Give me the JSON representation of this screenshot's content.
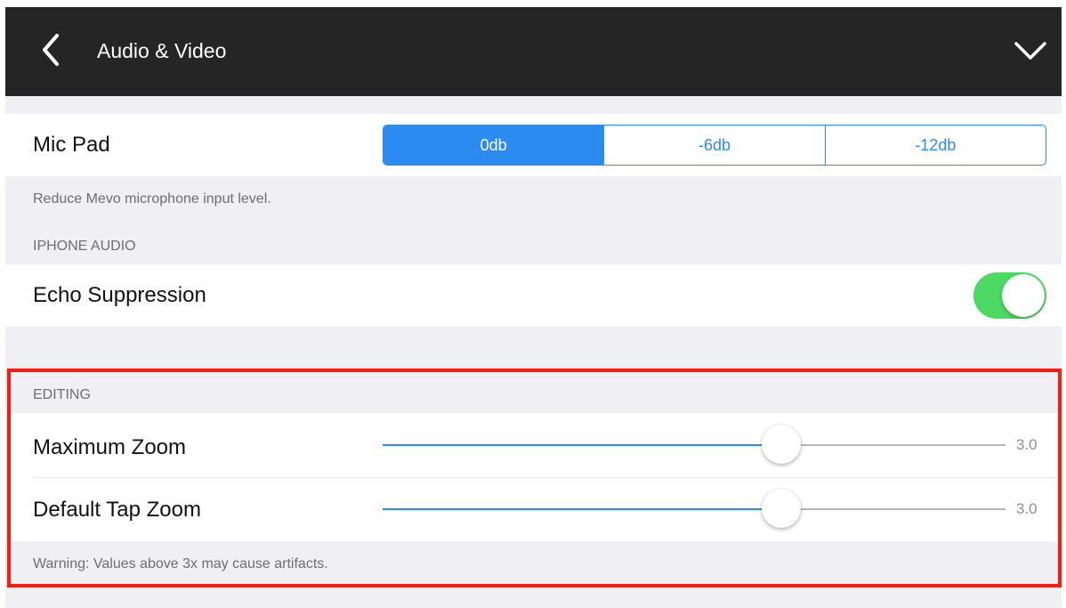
{
  "nav": {
    "title": "Audio & Video",
    "back_icon": "chevron-left-icon",
    "menu_icon": "chevron-down-icon"
  },
  "mic_pad": {
    "label": "Mic Pad",
    "options": [
      "0db",
      "-6db",
      "-12db"
    ],
    "selected": "0db",
    "footnote": "Reduce Mevo microphone input level."
  },
  "iphone_audio": {
    "header": "IPHONE AUDIO",
    "echo_suppression": {
      "label": "Echo Suppression",
      "on": true
    }
  },
  "editing": {
    "header": "EDITING",
    "maximum_zoom": {
      "label": "Maximum Zoom",
      "value": "3.0",
      "fraction": 0.64
    },
    "default_tap_zoom": {
      "label": "Default Tap Zoom",
      "value": "3.0",
      "fraction": 0.64
    },
    "footnote": "Warning: Values above 3x may cause artifacts."
  },
  "colors": {
    "nav_background": "#252525",
    "accent": "#2c8bf0",
    "toggle_on": "#4cd964",
    "highlight": "#ff1a0d",
    "grouped_background": "#f0eff4"
  }
}
